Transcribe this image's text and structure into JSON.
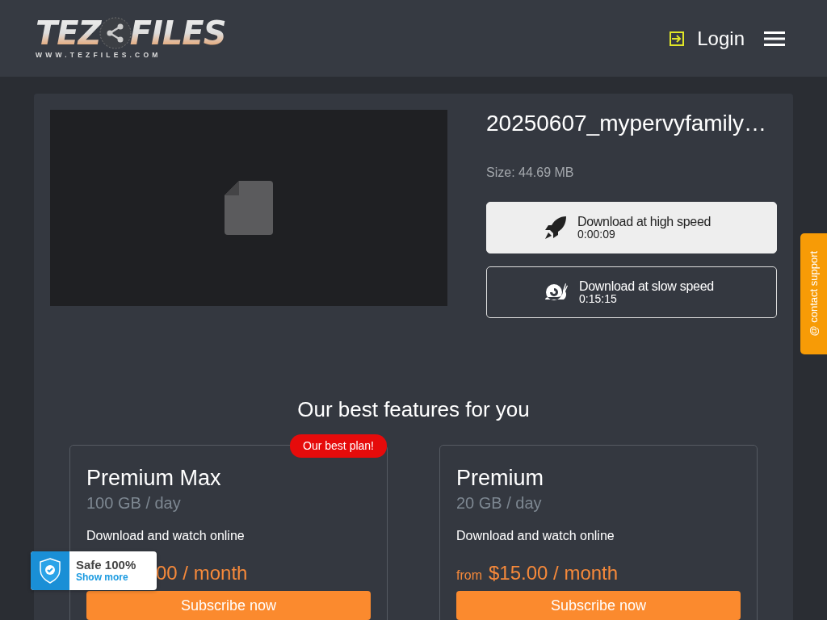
{
  "header": {
    "logo": {
      "main_left": "TEZ",
      "main_right": "FILES",
      "url": "WWW.TEZFILES.COM"
    },
    "login": "Login"
  },
  "file": {
    "name": "20250607_mypervyfamily…",
    "size": "Size: 44.69 MB",
    "downloads": [
      {
        "kind": "fast",
        "label": "Download at high speed",
        "time": "0:00:09"
      },
      {
        "kind": "slow",
        "label": "Download at slow speed",
        "time": "0:15:15"
      }
    ]
  },
  "features": {
    "title": "Our best features for you",
    "plans": [
      {
        "name": "Premium Max",
        "quota": "100 GB / day",
        "feature": "Download and watch online",
        "price": "00 / month",
        "ribbon": "Our best plan!",
        "button": "Subscribe now"
      },
      {
        "name": "Premium",
        "quota": "20 GB / day",
        "feature": "Download and watch online",
        "from": "from",
        "price": "$15.00 / month",
        "button": "Subscribe now"
      }
    ]
  },
  "contact_tab": "@ contact support",
  "safe_badge": {
    "title": "Safe 100%",
    "link": "Show more"
  }
}
